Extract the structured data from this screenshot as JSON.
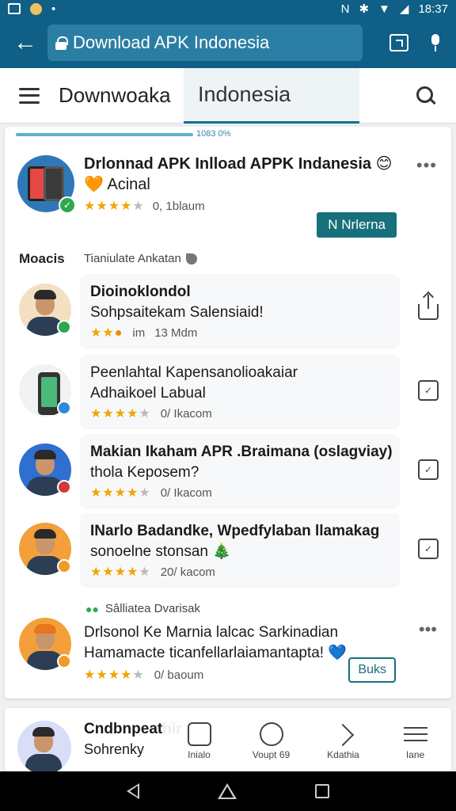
{
  "status_bar": {
    "time": "18:37"
  },
  "url_bar": {
    "url": "Download APK Indonesia"
  },
  "app_header": {
    "title": "Downwoaka",
    "active_tab": "Indonesia"
  },
  "progress_label": "1083 0%",
  "featured_app": {
    "title_line1": "Drlonnad APK Inlload APPK Indanesia 😊",
    "title_line2": "🧡 Acinal",
    "rating_stars": 4,
    "rating_text": "0, 1blaum",
    "install_label": "N Nrlerna"
  },
  "section": {
    "title": "Moacis",
    "subtitle": "Tianiulate Ankatan"
  },
  "list_items": [
    {
      "title": "Dioinoklondol",
      "subtitle": "Sohpsaitekam Salensiaid!",
      "rating_stars": 2.5,
      "rating_text": "im",
      "count": "13 Mdm",
      "action": "share"
    },
    {
      "title": "Peenlahtal Kapensanolioakaiar",
      "subtitle": "Adhaikoel Labual",
      "rating_stars": 4,
      "rating_text": "0/ Ikacom",
      "action": "download"
    },
    {
      "title": "Makian Ikaham APR .Braimana (oslagviay)",
      "subtitle": "thola Keposem?",
      "rating_stars": 4,
      "rating_text": "0/ Ikacom",
      "action": "download"
    },
    {
      "title": "INarlo Badandke, Wpedfylaban llamakag",
      "subtitle": "sonoelne stonsan 🎄",
      "rating_stars": 4,
      "rating_text": "20/ kacom",
      "action": "download"
    }
  ],
  "promo": {
    "label": "Sâlliatea Dvarisak",
    "title_line1": "Drlsonol Ke Marnia lalcac Sarkinadian",
    "title_line2": "Hamamacte ticanfellarlaiamantapta! 💙",
    "rating_stars": 4,
    "rating_text": "0/ baoum",
    "button_label": "Buks"
  },
  "bottom_card": {
    "title": "Cndbnpeathir",
    "subtitle": "Sohrenky"
  },
  "bottom_nav": [
    {
      "label": "Inialo",
      "icon": "home-icon"
    },
    {
      "label": "Voupt 69",
      "icon": "vote-icon"
    },
    {
      "label": "Kdathia",
      "icon": "send-icon"
    },
    {
      "label": "Iane",
      "icon": "menu-icon"
    }
  ],
  "colors": {
    "primary": "#0f5f86",
    "accent": "#17707c",
    "star": "#f0a500"
  }
}
